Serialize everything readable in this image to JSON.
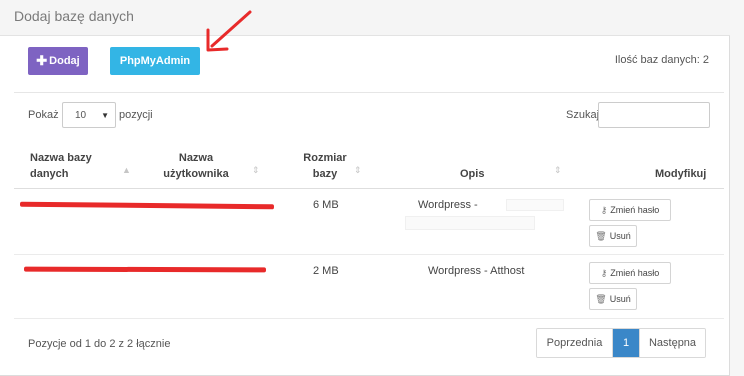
{
  "panel": {
    "title": "Dodaj bazę danych"
  },
  "toolbar": {
    "add_label": "Dodaj",
    "add_icon": "plus-icon",
    "phpmyadmin_label": "PhpMyAdmin"
  },
  "db_count_text": "Ilość baz danych: 2",
  "length_menu": {
    "prefix": "Pokaż",
    "selected": "10",
    "suffix": "pozycji"
  },
  "search": {
    "label": "Szukaj:",
    "value": ""
  },
  "table": {
    "headers": {
      "name_line1": "Nazwa bazy",
      "name_line2": "danych",
      "user_line1": "Nazwa",
      "user_line2": "użytkownika",
      "size_line1": "Rozmiar",
      "size_line2": "bazy",
      "desc": "Opis",
      "modify": "Modyfikuj"
    },
    "rows": [
      {
        "size": "6 MB",
        "description": "Wordpress -",
        "change_password": "Zmień hasło",
        "delete": "Usuń"
      },
      {
        "size": "2 MB",
        "description": "Wordpress - Atthost",
        "change_password": "Zmień hasło",
        "delete": "Usuń"
      }
    ]
  },
  "footer": {
    "info": "Pozycje od 1 do 2 z 2 łącznie",
    "prev": "Poprzednia",
    "page": "1",
    "next": "Następna"
  },
  "colors": {
    "add_button": "#7e63c2",
    "phpmyadmin_button": "#33b5e5",
    "active_page": "#3a87c8",
    "annotation": "#e82a2a"
  }
}
